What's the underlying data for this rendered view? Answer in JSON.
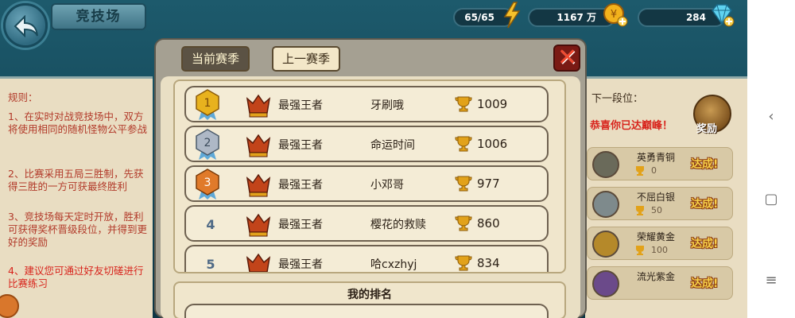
{
  "header": {
    "title": "竞技场",
    "stamina": "65/65",
    "gold": "1167 万",
    "gems": "284"
  },
  "tabs": {
    "current": "当前赛季",
    "previous": "上一赛季"
  },
  "rules": {
    "heading": "规则：",
    "items": [
      "1、在实时对战竞技场中，双方将使用相同的随机怪物公平参战",
      "2、比赛采用五局三胜制，先获得三胜的一方可获最终胜利",
      "3、竞技场每天定时开放，胜利可获得奖杯晋级段位，并得到更好的奖励",
      "4、建议您可通过好友切磋进行比赛练习"
    ]
  },
  "leaderboard": [
    {
      "rank": "1",
      "medal_color": "#e8b21e",
      "title": "最强王者",
      "name": "牙刷哦",
      "score": "1009"
    },
    {
      "rank": "2",
      "medal_color": "#aeb8c6",
      "title": "最强王者",
      "name": "命运时间",
      "score": "1006"
    },
    {
      "rank": "3",
      "medal_color": "#e07a2a",
      "title": "最强王者",
      "name": "小邓哥",
      "score": "977"
    },
    {
      "rank": "4",
      "title": "最强王者",
      "name": "樱花的救赎",
      "score": "860"
    },
    {
      "rank": "5",
      "title": "最强王者",
      "name": "哈cxzhyj",
      "score": "834"
    }
  ],
  "my_rank": {
    "label": "我的排名"
  },
  "side": {
    "next_tier": "下一段位：",
    "congrats": "恭喜你已达巅峰！",
    "reward_label": "奖励",
    "tiers": [
      {
        "name": "英勇青铜",
        "value": "0",
        "status": "达成!",
        "color": "#6a6a5a"
      },
      {
        "name": "不屈白银",
        "value": "50",
        "status": "达成!",
        "color": "#7e8a8c"
      },
      {
        "name": "荣耀黄金",
        "value": "100",
        "status": "达成!",
        "color": "#b5892a"
      },
      {
        "name": "流光紫金",
        "value": "",
        "status": "达成!",
        "color": "#6b4a8a"
      }
    ]
  },
  "colors": {
    "accent_red": "#d8241c",
    "gold": "#f6d04a"
  },
  "icons": {
    "back": "back-arrow-icon",
    "stamina": "lightning-icon",
    "gold": "gold-coin-icon",
    "gems": "diamond-icon",
    "close": "close-x-icon",
    "trophy": "trophy-icon"
  }
}
